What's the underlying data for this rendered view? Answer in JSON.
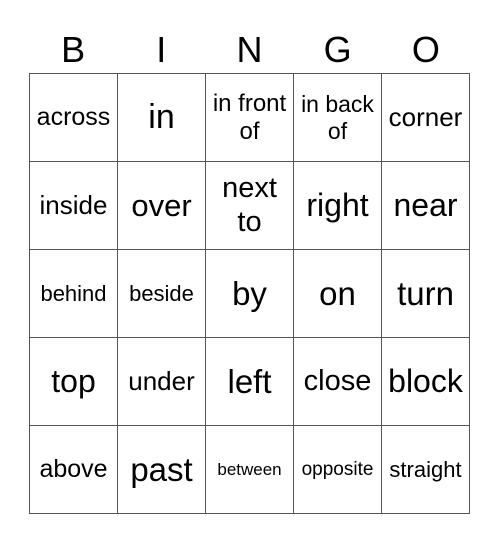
{
  "header": {
    "letters": [
      "B",
      "I",
      "N",
      "G",
      "O"
    ]
  },
  "card": {
    "rows": [
      [
        "across",
        "in",
        "in front of",
        "in back of",
        "corner"
      ],
      [
        "inside",
        "over",
        "next to",
        "right",
        "near"
      ],
      [
        "behind",
        "beside",
        "by",
        "on",
        "turn"
      ],
      [
        "top",
        "under",
        "left",
        "close",
        "block"
      ],
      [
        "above",
        "past",
        "between",
        "opposite",
        "straight"
      ]
    ]
  }
}
